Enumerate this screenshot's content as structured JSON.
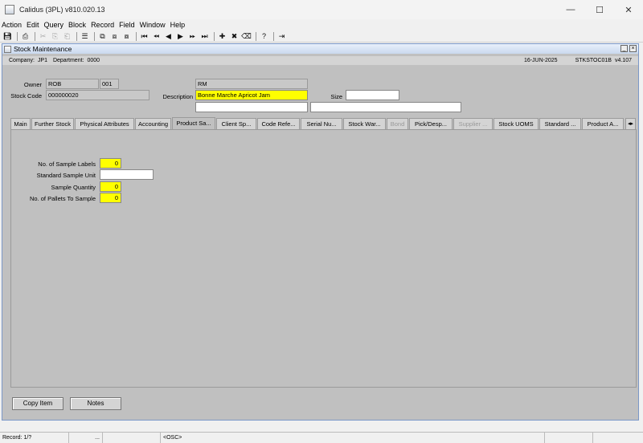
{
  "window": {
    "title": "Calidus (3PL) v810.020.13",
    "minimize": "—",
    "maximize": "☐",
    "close": "✕"
  },
  "menu": [
    "Action",
    "Edit",
    "Query",
    "Block",
    "Record",
    "Field",
    "Window",
    "Help"
  ],
  "form": {
    "title": "Stock Maintenance",
    "company_label": "Company:",
    "company": "JP1",
    "department_label": "Department:",
    "department": "0000",
    "date": "16-JUN-2025",
    "form_code": "STKSTOC01B",
    "version": "v4.107"
  },
  "header": {
    "owner_label": "Owner",
    "owner_code": "ROB",
    "owner_num": "001",
    "type_code": "RM",
    "stock_code_label": "Stock Code",
    "stock_code": "000000020",
    "description_label": "Description",
    "description": "Bonne Marche Apricot Jam",
    "size_label": "Size",
    "size": "",
    "extra1": "",
    "extra2": ""
  },
  "tabs": [
    {
      "label": "Main",
      "state": "normal"
    },
    {
      "label": "Further Stock",
      "state": "normal"
    },
    {
      "label": "Physical Attributes",
      "state": "normal"
    },
    {
      "label": "Accounting",
      "state": "normal"
    },
    {
      "label": "Product Sa...",
      "state": "active"
    },
    {
      "label": "Client Sp...",
      "state": "normal"
    },
    {
      "label": "Code Refe...",
      "state": "normal"
    },
    {
      "label": "Serial Nu...",
      "state": "normal"
    },
    {
      "label": "Stock War...",
      "state": "normal"
    },
    {
      "label": "Bond",
      "state": "disabled"
    },
    {
      "label": "Pick/Desp...",
      "state": "normal"
    },
    {
      "label": "Supplier ...",
      "state": "disabled"
    },
    {
      "label": "Stock UOMS",
      "state": "normal"
    },
    {
      "label": "Standard ...",
      "state": "normal"
    },
    {
      "label": "Product A...",
      "state": "normal"
    }
  ],
  "sampling": {
    "labels_label": "No. of Sample Labels",
    "labels_value": "0",
    "unit_label": "Standard Sample Unit",
    "unit_value": "",
    "qty_label": "Sample Quantity",
    "qty_value": "0",
    "pallets_label": "No. of Pallets To Sample",
    "pallets_value": "0"
  },
  "buttons": {
    "copy_item": "Copy Item",
    "notes": "Notes"
  },
  "status": {
    "record": "Record: 1/?",
    "seg2": "...",
    "mode": "<OSC>"
  },
  "colors": {
    "required_field": "#ffff00",
    "form_bg": "#c0c0c0",
    "window_border": "#7b98c8"
  }
}
